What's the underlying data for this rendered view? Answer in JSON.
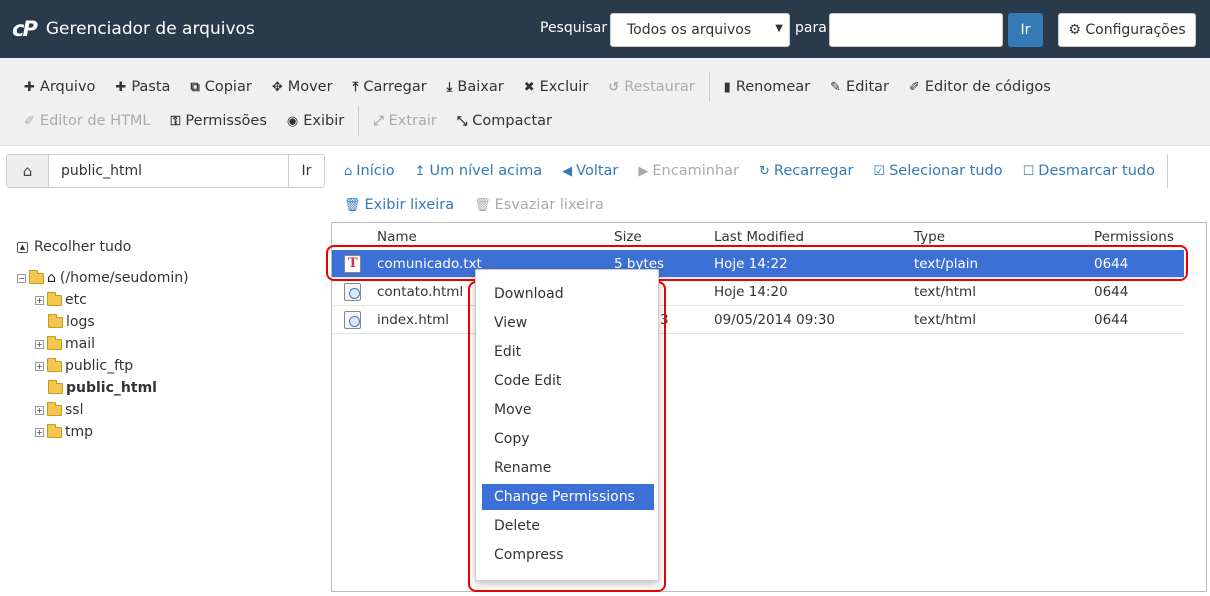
{
  "header": {
    "logo": "cP",
    "title": "Gerenciador de arquivos",
    "search_label": "Pesquisar",
    "search_scope": "Todos os arquivos",
    "for_label": "para",
    "search_value": "",
    "go_label": "Ir",
    "settings_label": "Configurações"
  },
  "toolbar": {
    "row1": [
      {
        "label": "Arquivo",
        "icon": "plus-icon"
      },
      {
        "label": "Pasta",
        "icon": "plus-icon"
      },
      {
        "label": "Copiar",
        "icon": "copy-icon"
      },
      {
        "label": "Mover",
        "icon": "move-icon"
      },
      {
        "label": "Carregar",
        "icon": "upload-icon"
      },
      {
        "label": "Baixar",
        "icon": "download-icon"
      },
      {
        "label": "Excluir",
        "icon": "close-icon"
      },
      {
        "label": "Restaurar",
        "icon": "undo-icon",
        "disabled": true
      },
      {
        "label": "Renomear",
        "icon": "file-icon"
      },
      {
        "label": "Editar",
        "icon": "pencil-icon"
      },
      {
        "label": "Editor de códigos",
        "icon": "edit-icon"
      }
    ],
    "row2": [
      {
        "label": "Editor de HTML",
        "icon": "edit-icon",
        "disabled": true
      },
      {
        "label": "Permissões",
        "icon": "key-icon"
      },
      {
        "label": "Exibir",
        "icon": "eye-icon"
      },
      {
        "label": "Extrair",
        "icon": "expand-icon",
        "disabled": true
      },
      {
        "label": "Compactar",
        "icon": "compress-icon"
      }
    ]
  },
  "pathbar": {
    "path": "public_html",
    "go_label": "Ir"
  },
  "nav": {
    "row1": [
      {
        "label": "Início",
        "icon": "home-icon"
      },
      {
        "label": "Um nível acima",
        "icon": "level-up-icon"
      },
      {
        "label": "Voltar",
        "icon": "arrow-left-icon"
      },
      {
        "label": "Encaminhar",
        "icon": "arrow-right-icon",
        "disabled": true
      },
      {
        "label": "Recarregar",
        "icon": "refresh-icon"
      },
      {
        "label": "Selecionar tudo",
        "icon": "check-square-icon"
      },
      {
        "label": "Desmarcar tudo",
        "icon": "square-icon"
      }
    ],
    "row2": [
      {
        "label": "Exibir lixeira",
        "icon": "trash-icon"
      },
      {
        "label": "Esvaziar lixeira",
        "icon": "trash-icon",
        "disabled": true
      }
    ]
  },
  "tree": {
    "collapse_all": "Recolher tudo",
    "root": "(/home/seudomin)",
    "folders": [
      {
        "name": "etc",
        "expandable": true
      },
      {
        "name": "logs",
        "expandable": false
      },
      {
        "name": "mail",
        "expandable": true
      },
      {
        "name": "public_ftp",
        "expandable": true
      },
      {
        "name": "public_html",
        "expandable": false,
        "active": true
      },
      {
        "name": "ssl",
        "expandable": true
      },
      {
        "name": "tmp",
        "expandable": true
      }
    ]
  },
  "files": {
    "columns": [
      "Name",
      "Size",
      "Last Modified",
      "Type",
      "Permissions"
    ],
    "rows": [
      {
        "name": "comunicado.txt",
        "size": "5 bytes",
        "modified": "Hoje 14:22",
        "type": "text/plain",
        "perms": "0644",
        "icon": "text-file-icon",
        "selected": true
      },
      {
        "name": "contato.html",
        "size": "",
        "modified": "Hoje 14:20",
        "type": "text/html",
        "perms": "0644",
        "icon": "html-file-icon"
      },
      {
        "name": "index.html",
        "size": "3",
        "modified": "09/05/2014 09:30",
        "type": "text/html",
        "perms": "0644",
        "icon": "html-file-icon"
      }
    ]
  },
  "context_menu": {
    "items": [
      "Download",
      "View",
      "Edit",
      "Code Edit",
      "Move",
      "Copy",
      "Rename",
      "Change Permissions",
      "Delete",
      "Compress"
    ],
    "active": "Change Permissions"
  },
  "colors": {
    "topbar": "#293a4a",
    "accent": "#337ab7",
    "selection": "#3d70d6",
    "highlight_outline": "#e00000"
  }
}
